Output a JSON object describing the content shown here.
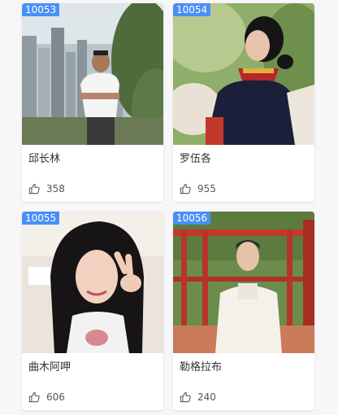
{
  "cards": [
    {
      "id": "10053",
      "name": "邱长林",
      "likes": "358",
      "image": "man-on-hilltop-city-view",
      "icon": "thumbs-up-icon"
    },
    {
      "id": "10054",
      "name": "罗伍各",
      "likes": "955",
      "image": "woman-in-traditional-costume",
      "icon": "thumbs-up-icon"
    },
    {
      "id": "10055",
      "name": "曲木阿呷",
      "likes": "606",
      "image": "girl-peace-sign-selfie",
      "icon": "thumbs-up-icon"
    },
    {
      "id": "10056",
      "name": "勒格拉布",
      "likes": "240",
      "image": "man-on-red-wooden-deck",
      "icon": "thumbs-up-icon"
    }
  ],
  "colors": {
    "badge": "#4a8ff5",
    "page_bg": "#f7f7f9",
    "card_bg": "#ffffff"
  }
}
